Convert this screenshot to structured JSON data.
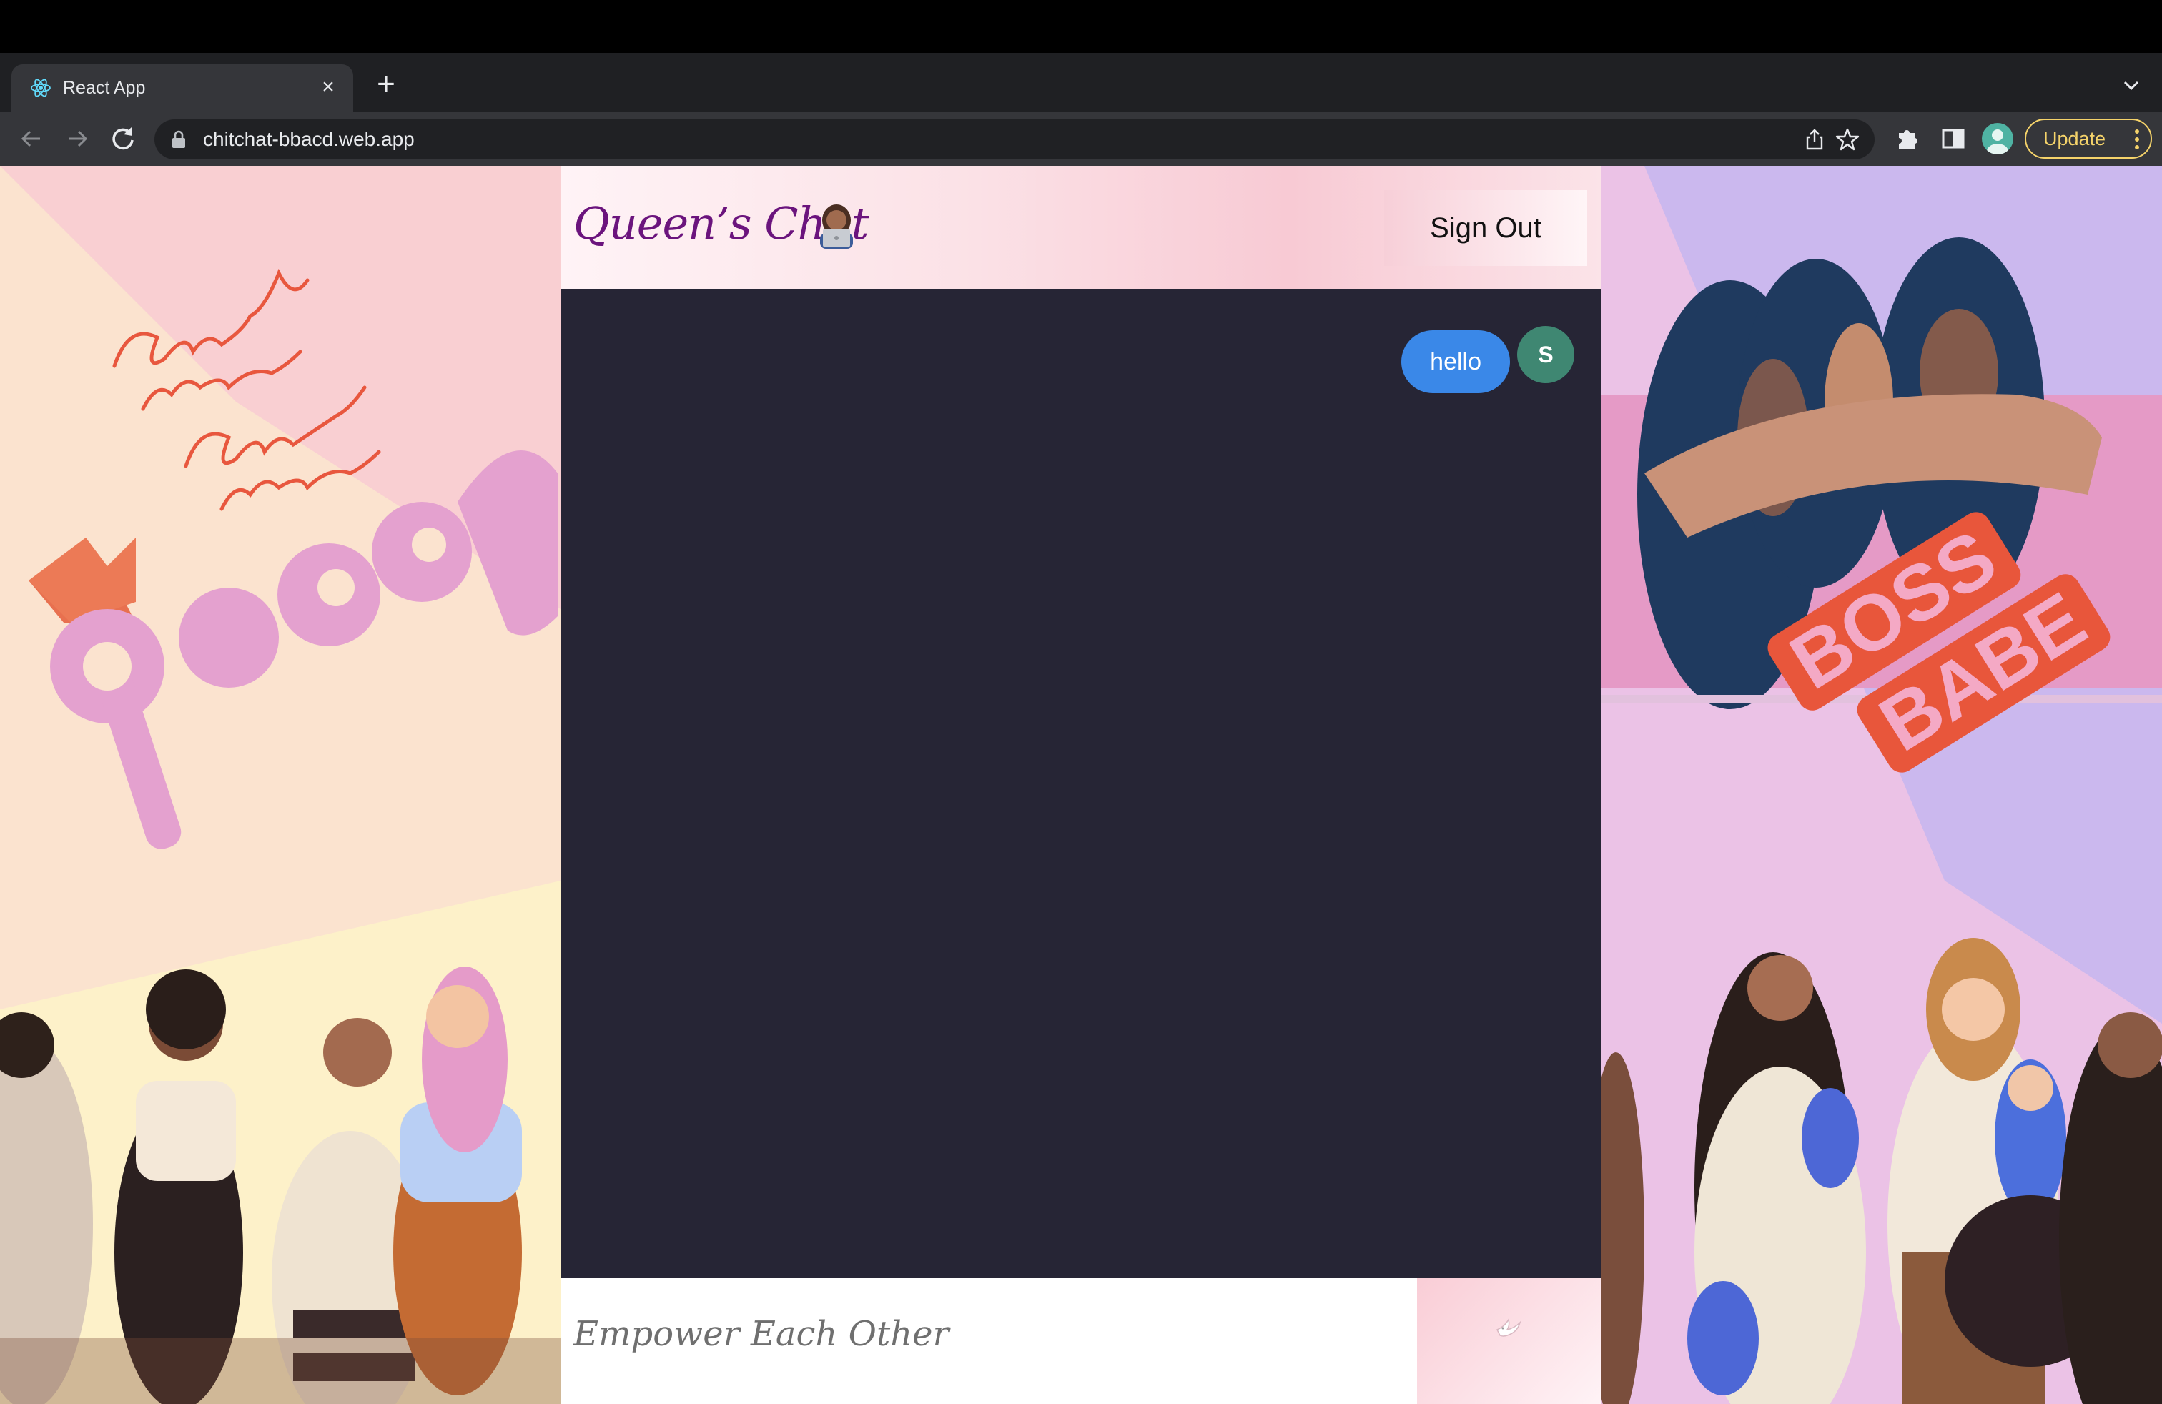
{
  "browser": {
    "tab": {
      "title": "React App",
      "favicon": "react-icon"
    },
    "address": {
      "url": "chitchat-bbacd.web.app"
    },
    "update_label": "Update",
    "icons": [
      "back-icon",
      "forward-icon",
      "reload-icon",
      "lock-icon",
      "share-icon",
      "star-icon",
      "extensions-icon",
      "side-panel-icon",
      "profile-icon",
      "more-icon"
    ]
  },
  "app": {
    "title": "Queen’s Chat",
    "title_emoji": "woman-technologist-emoji",
    "signout_label": "Sign Out",
    "messages": [
      {
        "text": "hello",
        "avatar_initial": "S",
        "side": "right"
      }
    ],
    "composer": {
      "placeholder": "Empower Each Other",
      "send_icon": "dove-icon"
    }
  },
  "decor": {
    "left_art": [
      "Empowered Women Empower Women",
      "queen"
    ],
    "right_art": [
      "BOSS BABE"
    ]
  },
  "colors": {
    "title": "#6b147d",
    "chat_bg": "#262535",
    "bubble": "#3a88e8",
    "avatar": "#3f8772"
  }
}
